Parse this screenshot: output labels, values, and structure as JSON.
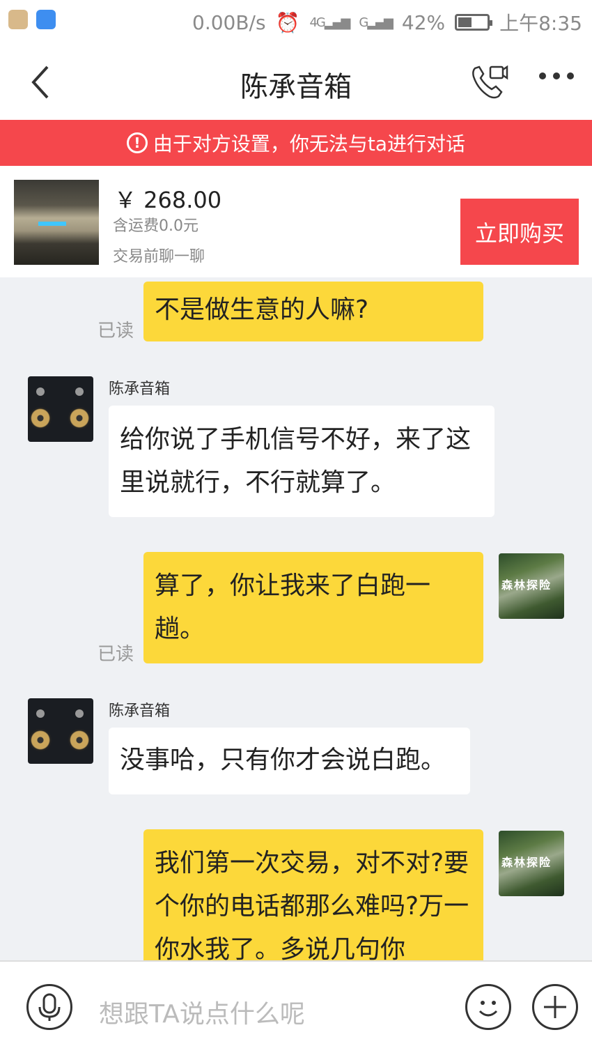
{
  "status_bar": {
    "net_speed": "0.00B/s",
    "network_4g": "4G",
    "network_g": "G",
    "battery": "42%",
    "time": "上午8:35"
  },
  "header": {
    "title": "陈承音箱"
  },
  "banner": {
    "text": "由于对方设置，你无法与ta进行对话",
    "icon": "!"
  },
  "product": {
    "price": "￥ 268.00",
    "shipping": "含运费0.0元",
    "chat_hint": "交易前聊一聊",
    "buy_label": "立即购买"
  },
  "messages": [
    {
      "from": "me",
      "text": "不是做生意的人嘛?",
      "read": "已读"
    },
    {
      "from": "them",
      "sender": "陈承音箱",
      "text": "给你说了手机信号不好，来了这里说就行，不行就算了。"
    },
    {
      "from": "me",
      "text": "算了，你让我来了白跑一趟。",
      "read": "已读"
    },
    {
      "from": "them",
      "sender": "陈承音箱",
      "text": "没事哈，只有你才会说白跑。"
    },
    {
      "from": "me",
      "text": "我们第一次交易，对不对?要个你的电话都那么难吗?万一你水我了。多说几句你"
    }
  ],
  "avatars": {
    "my_avatar_text": "森林探险"
  },
  "input": {
    "placeholder": "想跟TA说点什么呢"
  }
}
